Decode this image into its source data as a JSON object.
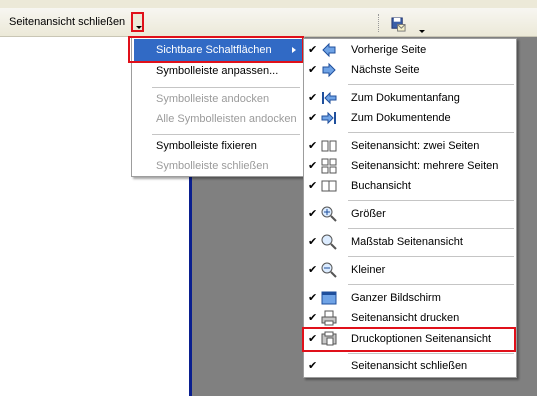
{
  "toolbar": {
    "label": "Seitenansicht schließen"
  },
  "menu1": {
    "items": [
      {
        "label": "Sichtbare Schaltflächen",
        "state": "highlighted"
      },
      {
        "label": "Symbolleiste anpassen...",
        "state": "enabled"
      },
      {
        "label": "Symbolleiste andocken",
        "state": "disabled"
      },
      {
        "label": "Alle Symbolleisten andocken",
        "state": "disabled"
      },
      {
        "label": "Symbolleiste fixieren",
        "state": "enabled"
      },
      {
        "label": "Symbolleiste schließen",
        "state": "disabled"
      }
    ]
  },
  "menu2": {
    "items": [
      {
        "label": "Vorherige Seite",
        "icon": "arrow-left-icon",
        "checked": true
      },
      {
        "label": "Nächste Seite",
        "icon": "arrow-right-icon",
        "checked": true
      },
      {
        "label": "Zum Dokumentanfang",
        "icon": "first-page-icon",
        "checked": true
      },
      {
        "label": "Zum Dokumentende",
        "icon": "last-page-icon",
        "checked": true
      },
      {
        "label": "Seitenansicht: zwei Seiten",
        "icon": "two-pages-icon",
        "checked": true
      },
      {
        "label": "Seitenansicht: mehrere Seiten",
        "icon": "multiple-pages-icon",
        "checked": true
      },
      {
        "label": "Buchansicht",
        "icon": "book-view-icon",
        "checked": true
      },
      {
        "label": "Größer",
        "icon": "zoom-in-icon",
        "checked": true
      },
      {
        "label": "Maßstab Seitenansicht",
        "icon": "zoom-icon",
        "checked": true
      },
      {
        "label": "Kleiner",
        "icon": "zoom-out-icon",
        "checked": true
      },
      {
        "label": "Ganzer Bildschirm",
        "icon": "fullscreen-icon",
        "checked": true
      },
      {
        "label": "Seitenansicht drucken",
        "icon": "print-icon",
        "checked": true
      },
      {
        "label": "Druckoptionen Seitenansicht",
        "icon": "print-options-icon",
        "checked": true
      },
      {
        "label": "Seitenansicht schließen",
        "icon": "",
        "checked": true
      }
    ]
  },
  "colors": {
    "highlight": "#316ac5",
    "annotation_red": "#e0101a",
    "page_border": "#0a1f8f",
    "background_gray": "#808080"
  }
}
